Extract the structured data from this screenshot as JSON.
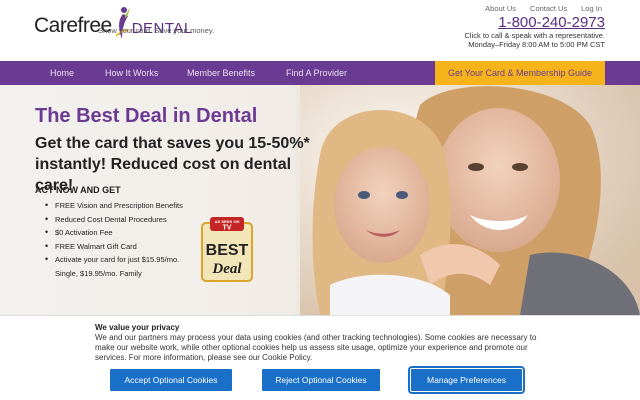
{
  "brand": {
    "name_part1": "Carefree",
    "name_part2": "DENTAL",
    "tagline": "Show your card. Save your money.",
    "color_primary": "#6b3a93",
    "color_accent": "#f6b41a"
  },
  "top_links": [
    "About Us",
    "Contact Us",
    "Log In"
  ],
  "phone": "1-800-240-2973",
  "call_text_1": "Click to call & speak with a representative.",
  "call_text_2": "Monday–Friday 8:00 AM to 5:00 PM CST",
  "nav": {
    "items": [
      "Home",
      "How It Works",
      "Member Benefits",
      "Find A Provider"
    ],
    "cta": "Get Your Card & Membership Guide"
  },
  "hero": {
    "title": "The Best Deal in Dental",
    "subtitle": "Get the card that saves you 15-50%* instantly! Reduced cost on dental care!",
    "act_heading": "ACT NOW AND GET",
    "bullets": [
      "FREE Vision and Prescription Benefits",
      "Reduced Cost Dental Procedures",
      "$0 Activation Fee",
      "FREE Walmart Gift Card",
      "Activate your card for just $15.95/mo. Single, $19.95/mo. Family"
    ],
    "badge": {
      "top": "AS SEEN ON",
      "tv": "TV",
      "line1": "BEST",
      "line2": "Deal"
    }
  },
  "cookie": {
    "title": "We value your privacy",
    "text": "We and our partners may process your data using cookies (and other tracking technologies). Some cookies are necessary to make our website work, while other optional cookies help us assess site usage, optimize your experience and promote our services. For more information, please see our Cookie Policy.",
    "accept": "Accept Optional Cookies",
    "reject": "Reject Optional Cookies",
    "manage": "Manage Preferences"
  }
}
